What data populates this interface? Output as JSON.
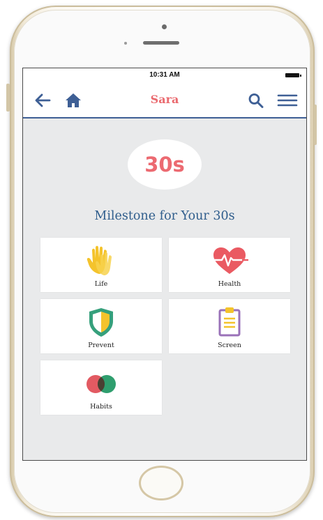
{
  "status_bar": {
    "time": "10:31 AM"
  },
  "header": {
    "title": "Sara"
  },
  "badge": {
    "text": "30s"
  },
  "main": {
    "heading": "Milestone for Your 30s",
    "categories": [
      {
        "label": "Life",
        "icon": "hand-icon",
        "color": "#f4c32c"
      },
      {
        "label": "Health",
        "icon": "heartbeat-icon",
        "color": "#ea5a62"
      },
      {
        "label": "Prevent",
        "icon": "shield-icon",
        "color": "#36a07c"
      },
      {
        "label": "Screen",
        "icon": "clipboard-icon",
        "color": "#9a72b8"
      },
      {
        "label": "Habits",
        "icon": "habits-icon",
        "color": "#e25a62"
      }
    ]
  },
  "colors": {
    "accent_blue": "#3e5f95",
    "accent_red": "#ea6a6f",
    "heading_blue": "#2f5d8c",
    "screen_bg": "#e9eaeb"
  }
}
